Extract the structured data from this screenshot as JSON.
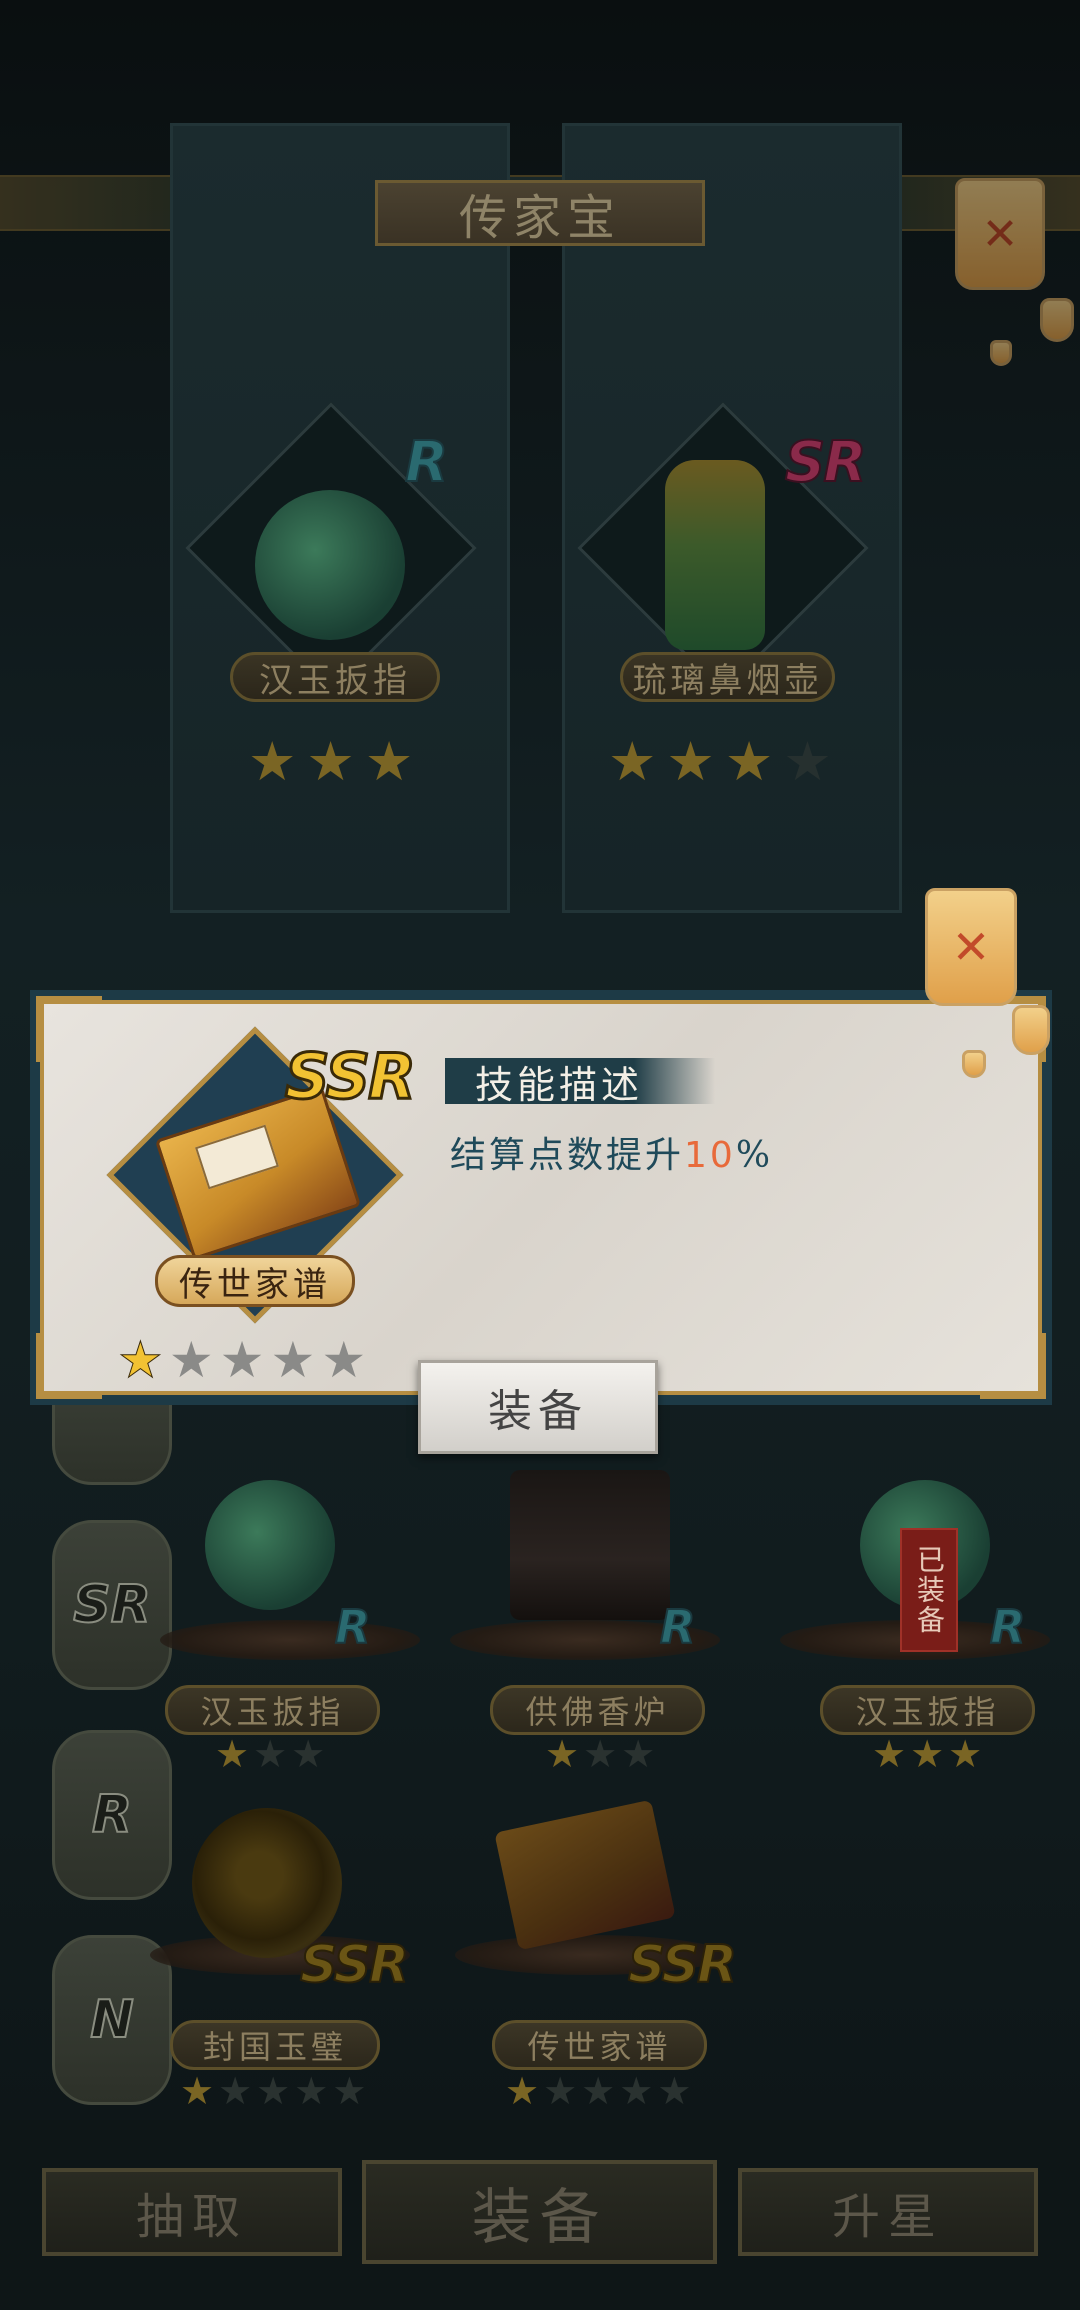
{
  "header": {
    "title": "传家宝"
  },
  "featured": [
    {
      "name": "汉玉扳指",
      "rarity": "R",
      "rarity_color": "#2a6a70",
      "stars": [
        1,
        1,
        1
      ]
    },
    {
      "name": "琉璃鼻烟壶",
      "rarity": "SR",
      "rarity_color": "#8a2a4a",
      "stars": [
        1,
        1,
        1,
        0
      ]
    }
  ],
  "detail": {
    "item_name": "传世家谱",
    "rarity": "SSR",
    "stars": [
      1,
      0,
      0,
      0,
      0
    ],
    "skill_title": "技能描述",
    "skill_desc_prefix": "结算点数提升",
    "skill_desc_value": "10",
    "skill_desc_suffix": "%",
    "equip_label": "装备"
  },
  "tabs": [
    {
      "label": "SR"
    },
    {
      "label": "R"
    },
    {
      "label": "N"
    }
  ],
  "grid": [
    {
      "name": "汉玉扳指",
      "rarity": "R",
      "stars": [
        1,
        0,
        0
      ],
      "equipped": false
    },
    {
      "name": "供佛香炉",
      "rarity": "R",
      "stars": [
        1,
        0,
        0
      ],
      "equipped": false
    },
    {
      "name": "汉玉扳指",
      "rarity": "R",
      "stars": [
        1,
        1,
        1
      ],
      "equipped": true,
      "equipped_label": "已装备"
    },
    {
      "name": "封国玉璧",
      "rarity": "SSR",
      "stars": [
        1,
        0,
        0,
        0,
        0
      ],
      "equipped": false
    },
    {
      "name": "传世家谱",
      "rarity": "SSR",
      "stars": [
        1,
        0,
        0,
        0,
        0
      ],
      "equipped": false
    }
  ],
  "bottom": {
    "draw": "抽取",
    "equip": "装备",
    "star_up": "升星"
  },
  "colors": {
    "accent_gold": "#b68e42",
    "panel_teal": "#1d3a46",
    "highlight": "#e86a3a"
  }
}
